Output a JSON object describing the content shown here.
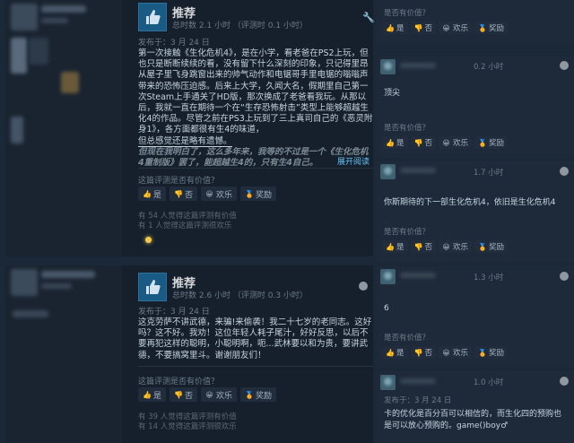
{
  "colors": {
    "background": "#1b2838",
    "card": "#16202d",
    "link": "#66c0f4",
    "thumb": "#1a5b85",
    "award": "#f2c94c"
  },
  "reviews": [
    {
      "recommendation": "推荐",
      "hours": "总时数 2.1 小时 （评测时 0.1 小时）",
      "posted": "发布于：3 月 24 日",
      "paragraphs": [
        "第一次接触《生化危机4》，是在小学，看老爸在PS2上玩，但也只是断断续续的看，没有留下什么深刻的印象，只记得里昂从屋子里飞身跳窗出来的帅气动作和电锯哥手里电锯的嗡嗡声带来的恐怖压迫感。后来上大学，久闻大名，假期里自己第一次Steam上手通关了HD版，那次换成了老爸看我玩。从那以后，我就一直在期待一个在“生存恐怖射击”类型上能够超越生化4的作品。尽管之前在PS3上玩到了三上真司自己的《恶灵附身1》，各方面都很有生4的味道，",
        "但总感觉还是略有遗憾。"
      ],
      "faded_text": "但现在我明白了，这么多年来，我等的不过是一个《生化危机4重制版》罢了，能超越生4的，只有生4自己。",
      "expand_label": "展开阅读",
      "helpful_question": "这篇评测是否有价值？",
      "buttons": {
        "yes": "是",
        "no": "否",
        "funny": "欢乐",
        "award": "奖励"
      },
      "helpful_count": "有 54 人觉得这篇评测有价值",
      "funny_count": "有 1 人觉得这篇评测很欢乐"
    },
    {
      "recommendation": "推荐",
      "hours": "总时数 2.6 小时 （评测时 0.3 小时）",
      "posted": "发布于：3 月 24 日",
      "paragraphs": [
        "这克劳萨不讲武德，来骗!来偷袭！我二十七岁的老同志。这好吗？这不好。我劝！这位年轻人耗子尾汁，好好反思，以后不要再犯这样的聪明，小聪明啊，呃...武林要以和为贵，要讲武德，不要搞窝里斗。谢谢朋友们！"
      ],
      "helpful_question": "这篇评测是否有价值？",
      "buttons": {
        "yes": "是",
        "no": "否",
        "funny": "欢乐",
        "award": "奖励"
      },
      "helpful_count": "有 39 人觉得这篇评测有价值",
      "funny_count": "有 14 人觉得这篇评测很欢乐"
    }
  ],
  "comments": [
    {
      "time": "",
      "text": "",
      "helpful_question": "是否有价值？",
      "buttons": {
        "yes": "是",
        "no": "否",
        "funny": "欢乐",
        "award": "奖励"
      }
    },
    {
      "time": "0.2 小时",
      "text": "顶尖",
      "helpful_question": "是否有价值？",
      "buttons": {
        "yes": "是",
        "no": "否",
        "funny": "欢乐",
        "award": "奖励"
      }
    },
    {
      "time": "1.7 小时",
      "text": "你斯期待的下一部生化危机4，依旧是生化危机4",
      "helpful_question": "是否有价值？",
      "buttons": {
        "yes": "是",
        "no": "否",
        "funny": "欢乐",
        "award": "奖励"
      }
    },
    {
      "time": "1.3 小时",
      "text": "6",
      "helpful_question": "是否有价值？",
      "buttons": {
        "yes": "是",
        "no": "否",
        "funny": "欢乐",
        "award": "奖励"
      }
    },
    {
      "time": "1.0 小时",
      "posted": "发布于：3 月 24 日",
      "text": "卡的优化是百分百可以相信的，而生化四的预购也是可以放心预购的。game()boy♂"
    }
  ],
  "icons": {
    "thumbs_up": "thumbs-up-icon",
    "thumbs_down": "thumbs-down-icon",
    "funny": "laugh-icon",
    "award": "award-icon",
    "steam": "steam-logo-icon"
  }
}
